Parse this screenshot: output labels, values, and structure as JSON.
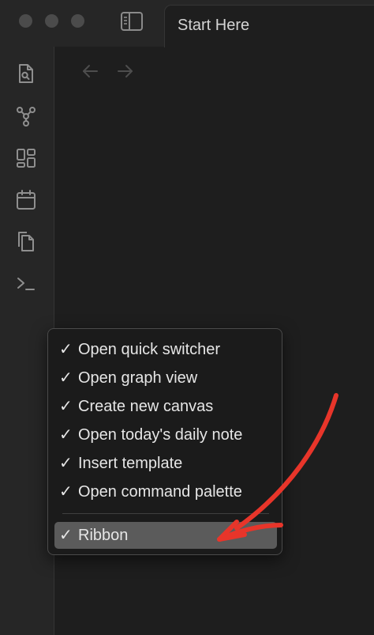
{
  "window": {
    "tab_title": "Start Here"
  },
  "ribbon": {
    "items": [
      {
        "icon": "search-file-icon"
      },
      {
        "icon": "graph-view-icon"
      },
      {
        "icon": "canvas-grid-icon"
      },
      {
        "icon": "calendar-icon"
      },
      {
        "icon": "copy-files-icon"
      },
      {
        "icon": "terminal-icon"
      }
    ]
  },
  "context_menu": {
    "items": [
      {
        "check": "✓",
        "label": "Open quick switcher"
      },
      {
        "check": "✓",
        "label": "Open graph view"
      },
      {
        "check": "✓",
        "label": "Create new canvas"
      },
      {
        "check": "✓",
        "label": "Open today's daily note"
      },
      {
        "check": "✓",
        "label": "Insert template"
      },
      {
        "check": "✓",
        "label": "Open command palette"
      }
    ],
    "ribbon_item": {
      "check": "✓",
      "label": "Ribbon"
    }
  },
  "colors": {
    "background": "#1e1e1e",
    "ribbon": "#262626",
    "menu_highlight": "#5b5b5b",
    "annotation_arrow": "#e8352a"
  }
}
